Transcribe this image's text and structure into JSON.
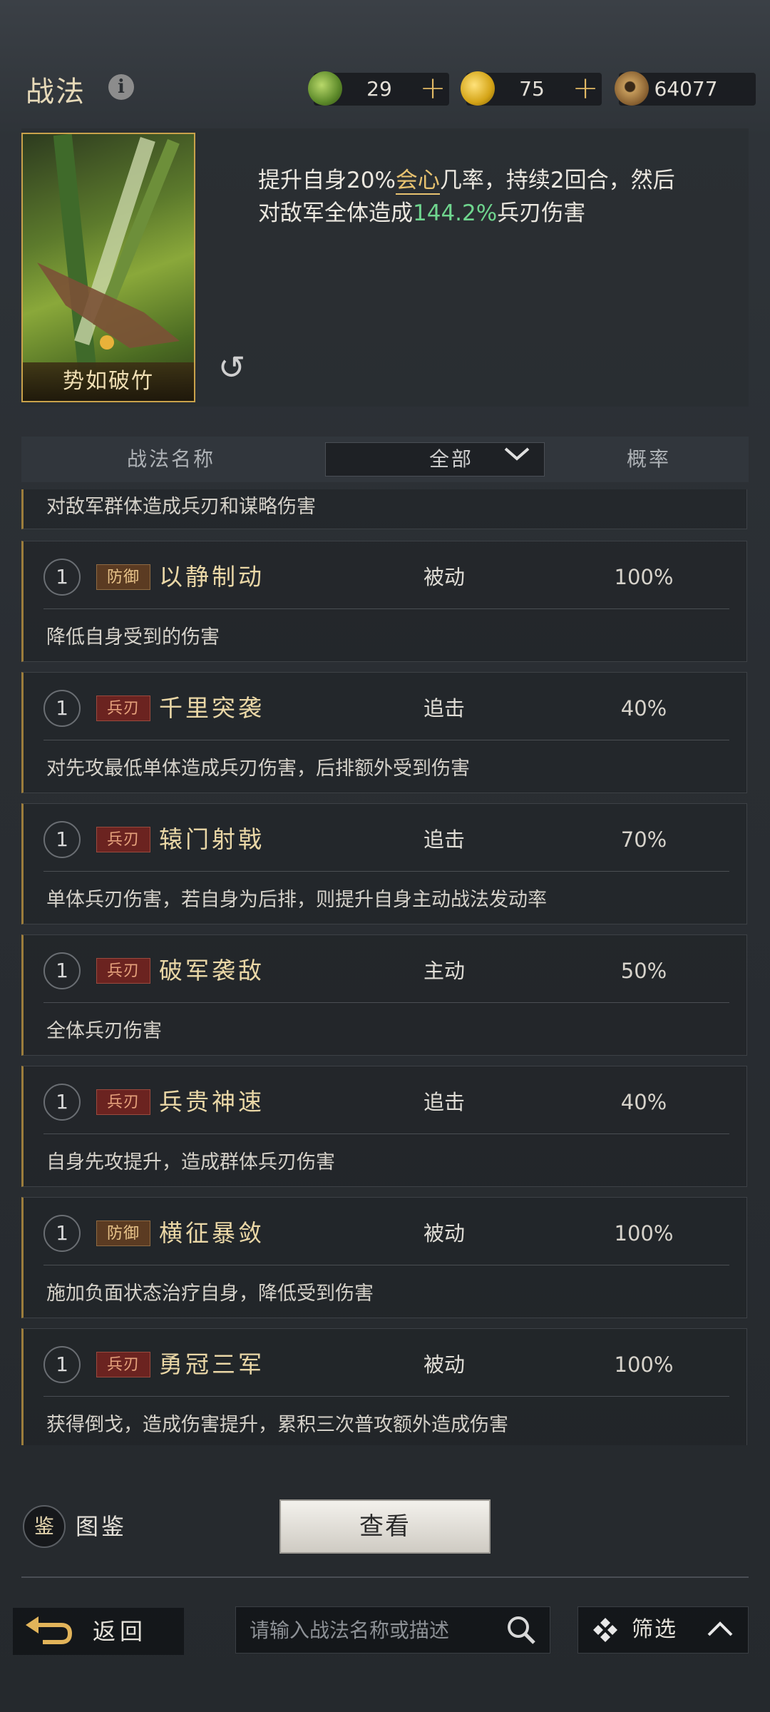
{
  "header": {
    "title": "战法",
    "resources": [
      {
        "icon": "jade-coin-icon",
        "value": "29",
        "has_plus": true
      },
      {
        "icon": "gold-coin-icon",
        "value": "75",
        "has_plus": true
      },
      {
        "icon": "copper-coin-icon",
        "value": "64077",
        "has_plus": false
      }
    ]
  },
  "skill": {
    "card_name": "势如破竹",
    "desc_part1": "提升自身20%",
    "desc_highlight1": "会心",
    "desc_part2": "几率，持续2回合，然后",
    "desc_part3": "对敌军全体造成",
    "desc_highlight2": "144.2%",
    "desc_part4": "兵刃伤害"
  },
  "table_header": {
    "col_name": "战法名称",
    "filter_value": "全部",
    "col_rate": "概率"
  },
  "partial_row_desc": "对敌军群体造成兵刃和谋略伤害",
  "skills": [
    {
      "level": "1",
      "tag": "防御",
      "tag_type": "def",
      "name": "以静制动",
      "type": "被动",
      "rate": "100%",
      "desc": "降低自身受到的伤害"
    },
    {
      "level": "1",
      "tag": "兵刃",
      "tag_type": "atk",
      "name": "千里突袭",
      "type": "追击",
      "rate": "40%",
      "desc": "对先攻最低单体造成兵刃伤害，后排额外受到伤害"
    },
    {
      "level": "1",
      "tag": "兵刃",
      "tag_type": "atk",
      "name": "辕门射戟",
      "type": "追击",
      "rate": "70%",
      "desc": "单体兵刃伤害，若自身为后排，则提升自身主动战法发动率"
    },
    {
      "level": "1",
      "tag": "兵刃",
      "tag_type": "atk",
      "name": "破军袭敌",
      "type": "主动",
      "rate": "50%",
      "desc": "全体兵刃伤害"
    },
    {
      "level": "1",
      "tag": "兵刃",
      "tag_type": "atk",
      "name": "兵贵神速",
      "type": "追击",
      "rate": "40%",
      "desc": "自身先攻提升，造成群体兵刃伤害"
    },
    {
      "level": "1",
      "tag": "防御",
      "tag_type": "def",
      "name": "横征暴敛",
      "type": "被动",
      "rate": "100%",
      "desc": "施加负面状态治疗自身，降低受到伤害"
    },
    {
      "level": "1",
      "tag": "兵刃",
      "tag_type": "atk",
      "name": "勇冠三军",
      "type": "被动",
      "rate": "100%",
      "desc": "获得倒戈，造成伤害提升，累积三次普攻额外造成伤害"
    }
  ],
  "footer": {
    "codex_glyph": "鉴",
    "codex_label": "图鉴",
    "view_label": "查看",
    "back_label": "返回",
    "search_placeholder": "请输入战法名称或描述",
    "filter_label": "筛选"
  }
}
